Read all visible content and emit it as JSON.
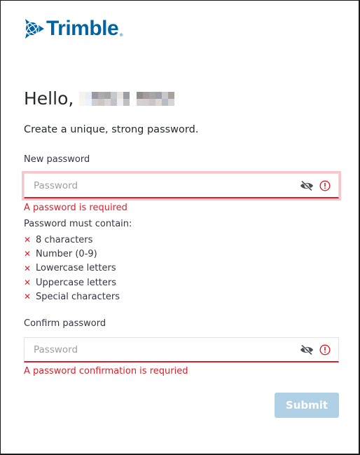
{
  "brand": {
    "name": "Trimble",
    "registered_mark": "®",
    "color": "#0063a3"
  },
  "greeting": {
    "prefix": "Hello,",
    "name_redacted": true
  },
  "subtitle": "Create a unique, strong password.",
  "new_password": {
    "label": "New password",
    "placeholder": "Password",
    "value": "",
    "toggle_icon": "eye-slash-icon",
    "status_icon": "exclamation-circle-icon",
    "error": "A password is required",
    "focused": true
  },
  "requirements": {
    "title": "Password must contain:",
    "status_icon": "x-mark-icon",
    "items": [
      {
        "label": "8 characters",
        "met": false
      },
      {
        "label": "Number (0-9)",
        "met": false
      },
      {
        "label": "Lowercase letters",
        "met": false
      },
      {
        "label": "Uppercase letters",
        "met": false
      },
      {
        "label": "Special characters",
        "met": false
      }
    ]
  },
  "confirm_password": {
    "label": "Confirm password",
    "placeholder": "Password",
    "value": "",
    "toggle_icon": "eye-slash-icon",
    "status_icon": "exclamation-circle-icon",
    "error": "A password confirmation is requried"
  },
  "submit": {
    "label": "Submit",
    "disabled": true
  },
  "colors": {
    "error": "#da212c",
    "focus_ring": "#f7c6c9",
    "button_disabled": "#afd0e5",
    "text": "#252a2e"
  }
}
